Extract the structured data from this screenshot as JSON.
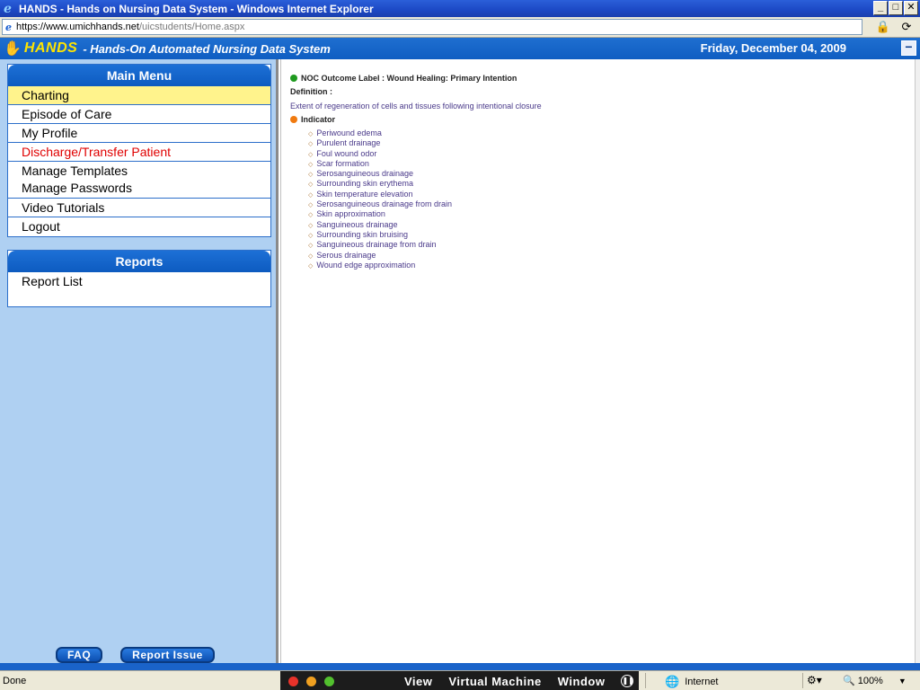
{
  "window": {
    "title": "HANDS - Hands on Nursing Data System - Windows Internet Explorer",
    "buttons": {
      "minimize": "_",
      "maximize": "□",
      "close": "✕"
    }
  },
  "address": {
    "url_host": "https://www.umichhands.net",
    "url_path": "/uicstudents/Home.aspx"
  },
  "header": {
    "brand": "HANDS",
    "subtitle": "- Hands-On Automated Nursing Data System",
    "date": "Friday, December 04, 2009",
    "collapse": "−"
  },
  "sidebar": {
    "main_menu": {
      "title": "Main Menu",
      "items": [
        "Charting",
        "Episode of Care",
        "My Profile",
        "Discharge/Transfer Patient",
        "Manage Templates",
        "Manage Passwords",
        "Video Tutorials",
        "Logout"
      ]
    },
    "reports": {
      "title": "Reports",
      "items": [
        "Report List"
      ]
    },
    "buttons": {
      "faq": "FAQ",
      "report_issue": "Report Issue"
    }
  },
  "content": {
    "noc_label": "NOC Outcome Label : Wound Healing: Primary Intention",
    "definition_label": "Definition :",
    "definition_text": "Extent of regeneration of cells and tissues following intentional closure",
    "indicator_label": "Indicator",
    "indicators": [
      "Periwound edema",
      "Purulent drainage",
      "Foul wound odor",
      "Scar formation",
      "Serosanguineous drainage",
      "Surrounding skin erythema",
      "Skin temperature elevation",
      "Serosanguineous drainage from drain",
      "Skin approximation",
      "Sanguineous drainage",
      "Surrounding skin bruising",
      "Sanguineous drainage from drain",
      "Serous drainage",
      "Wound edge approximation"
    ]
  },
  "statusbar": {
    "status": "Done",
    "vm_menus": [
      "View",
      "Virtual Machine",
      "Window"
    ],
    "zone": "Internet",
    "zoom": "100%"
  },
  "colors": {
    "brand_yellow": "#ffe400",
    "header_blue": "#0f5dc2",
    "sidebar_bg": "#afd0f2",
    "active_item": "#fff38c",
    "discharge_red": "#e00000",
    "noc_dot": "#1f9a1f",
    "indicator_dot": "#f07a10"
  }
}
